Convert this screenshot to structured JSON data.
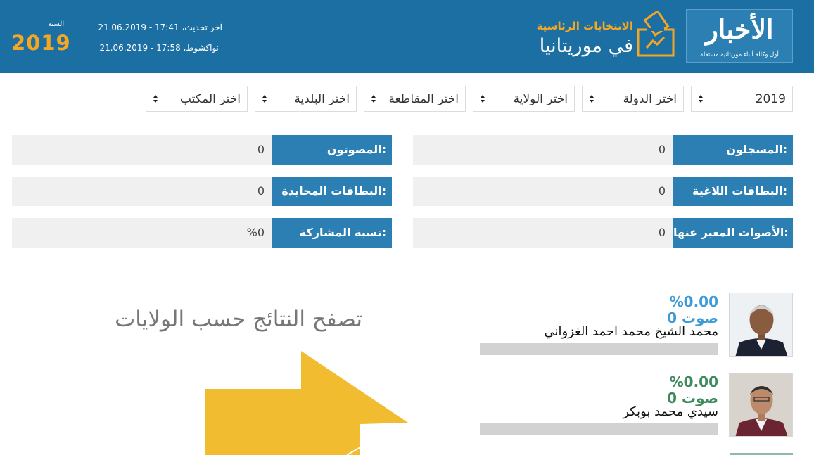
{
  "header": {
    "logo_text": "الأخبار",
    "logo_tagline": "أول وكالة أنباء موريتانية مستقلة",
    "brand_subtitle": "الانتخابات الرئاسية",
    "brand_title": "في موريتانيا",
    "last_update": "آخر تحديث، 17:41 - 21.06.2019",
    "location_time": "نواكشوط، 17:58 - 21.06.2019",
    "year_label": "السنة",
    "year_value": "2019",
    "colors": {
      "header_bg": "#1b6fa3",
      "accent": "#f5a623"
    }
  },
  "filters": [
    {
      "name": "year",
      "value": "2019"
    },
    {
      "name": "country",
      "value": "اختر الدولة"
    },
    {
      "name": "wilaya",
      "value": "اختر الولاية"
    },
    {
      "name": "moughataa",
      "value": "اختر المقاطعة"
    },
    {
      "name": "commune",
      "value": "اختر البلدية"
    },
    {
      "name": "office",
      "value": "اختر المكتب"
    }
  ],
  "stats": {
    "registered": {
      "label": "المسجلون:",
      "value": "0"
    },
    "voters": {
      "label": "المصوتون:",
      "value": "0"
    },
    "invalid": {
      "label": "البطاقات اللاغية:",
      "value": "0"
    },
    "neutral": {
      "label": "البطاقات المحايدة:",
      "value": "0"
    },
    "expressed": {
      "label": "الأصوات المعبر عنها:",
      "value": "0"
    },
    "turnout": {
      "label": "نسبة المشاركة:",
      "value": "%0"
    }
  },
  "browse": {
    "title": "تصفح النتائج حسب الولايات",
    "arrow_color": "#f1bc2f"
  },
  "candidates": [
    {
      "percent": "%0.00",
      "votes": "0 صوت",
      "name": "محمد الشيخ محمد احمد الغزواني",
      "color": "#3d9ad6",
      "share": 0
    },
    {
      "percent": "%0.00",
      "votes": "0 صوت",
      "name": "سيدي محمد بوبكر",
      "color": "#3e8a5e",
      "share": 0
    }
  ]
}
